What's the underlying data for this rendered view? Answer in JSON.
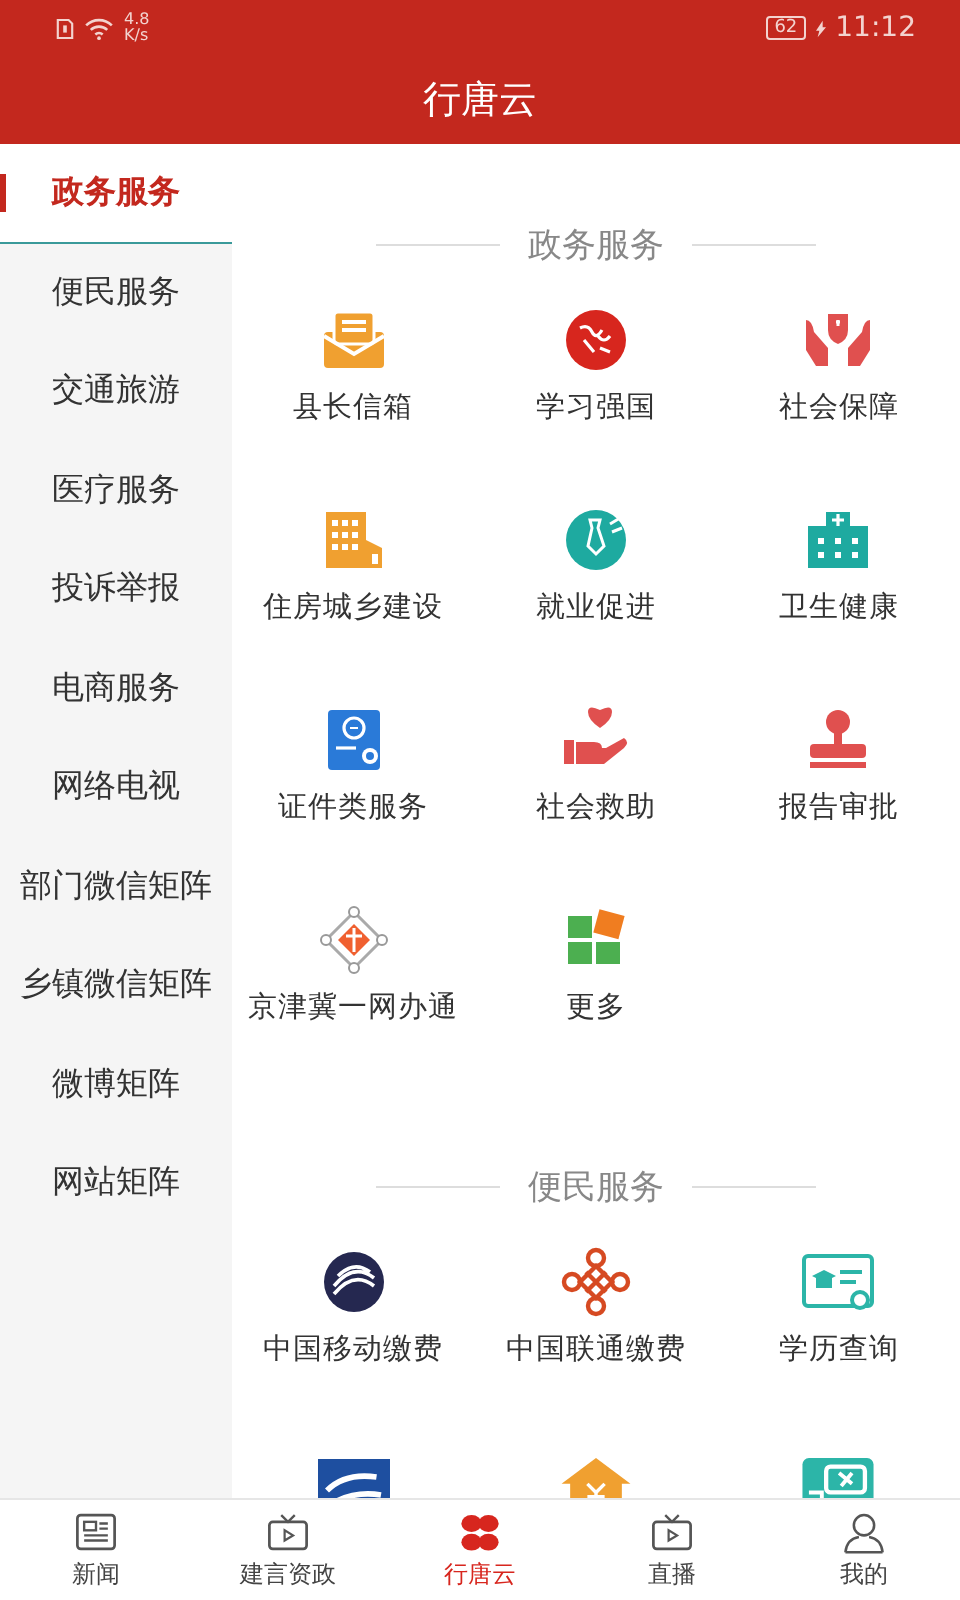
{
  "status_bar": {
    "speed_value": "4.8",
    "speed_unit": "K/s",
    "battery": "62",
    "time": "11:12"
  },
  "header": {
    "title": "行唐云"
  },
  "sidebar": {
    "items": [
      {
        "label": "政务服务",
        "selected": true
      },
      {
        "label": "便民服务",
        "selected": false
      },
      {
        "label": "交通旅游",
        "selected": false
      },
      {
        "label": "医疗服务",
        "selected": false
      },
      {
        "label": "投诉举报",
        "selected": false
      },
      {
        "label": "电商服务",
        "selected": false
      },
      {
        "label": "网络电视",
        "selected": false
      },
      {
        "label": "部门微信矩阵",
        "selected": false
      },
      {
        "label": "乡镇微信矩阵",
        "selected": false
      },
      {
        "label": "微博矩阵",
        "selected": false
      },
      {
        "label": "网站矩阵",
        "selected": false
      }
    ]
  },
  "sections": [
    {
      "title": "政务服务",
      "items": [
        {
          "label": "县长信箱"
        },
        {
          "label": "学习强国"
        },
        {
          "label": "社会保障"
        },
        {
          "label": "住房城乡建设"
        },
        {
          "label": "就业促进"
        },
        {
          "label": "卫生健康"
        },
        {
          "label": "证件类服务"
        },
        {
          "label": "社会救助"
        },
        {
          "label": "报告审批"
        },
        {
          "label": "京津冀一网办通"
        },
        {
          "label": "更多"
        }
      ]
    },
    {
      "title": "便民服务",
      "items": [
        {
          "label": "中国移动缴费"
        },
        {
          "label": "中国联通缴费"
        },
        {
          "label": "学历查询"
        }
      ]
    }
  ],
  "bottom_nav": [
    {
      "label": "新闻",
      "selected": false
    },
    {
      "label": "建言资政",
      "selected": false
    },
    {
      "label": "行唐云",
      "selected": true
    },
    {
      "label": "直播",
      "selected": false
    },
    {
      "label": "我的",
      "selected": false
    }
  ]
}
